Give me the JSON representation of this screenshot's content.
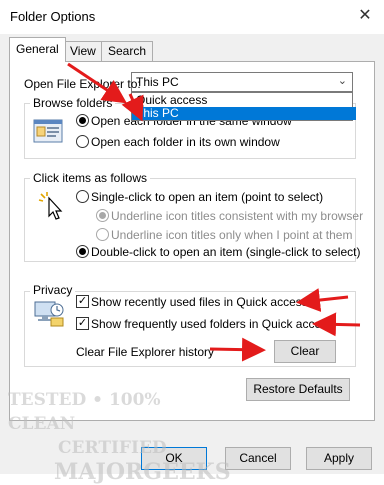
{
  "window": {
    "title": "Folder Options",
    "close_glyph": "✕"
  },
  "tabs": [
    {
      "label": "General"
    },
    {
      "label": "View"
    },
    {
      "label": "Search"
    }
  ],
  "open_explorer": {
    "label": "Open File Explorer to:",
    "value": "This PC",
    "options": [
      "Quick access",
      "This PC"
    ]
  },
  "browse": {
    "title": "Browse folders",
    "opt1": "Open each folder in the same window",
    "opt2": "Open each folder in its own window"
  },
  "click": {
    "title": "Click items as follows",
    "single": "Single-click to open an item (point to select)",
    "underline1": "Underline icon titles consistent with my browser",
    "underline2": "Underline icon titles only when I point at them",
    "double": "Double-click to open an item (single-click to select)"
  },
  "privacy": {
    "title": "Privacy",
    "recent_files": "Show recently used files in Quick access",
    "frequent_folders": "Show frequently used folders in Quick access",
    "clear_label": "Clear File Explorer history",
    "clear_button": "Clear"
  },
  "restore_button": "Restore Defaults",
  "footer": {
    "ok": "OK",
    "cancel": "Cancel",
    "apply": "Apply"
  },
  "watermark": {
    "line1": "TESTED • 100% CLEAN",
    "line2": "CERTIFIED",
    "line3": "MAJORGEEKS"
  },
  "colors": {
    "accent": "#0078d7",
    "arrow": "#e31b1b"
  }
}
